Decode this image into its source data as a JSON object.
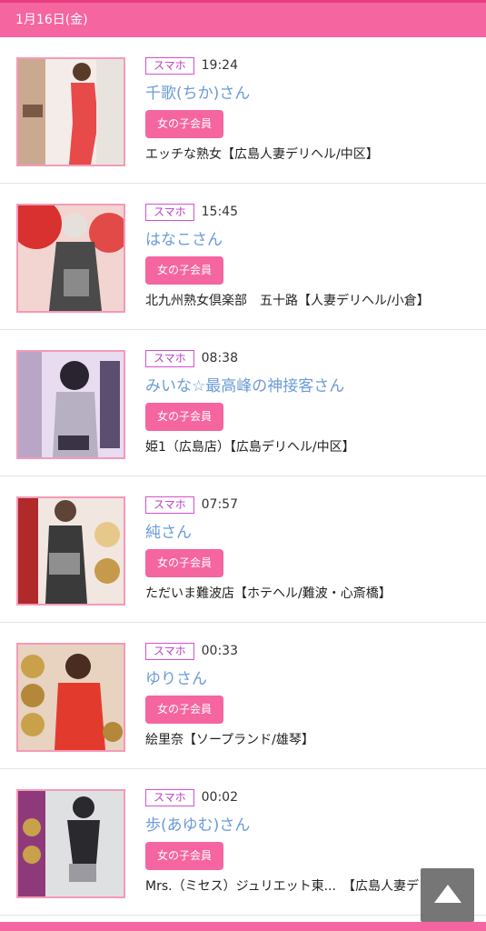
{
  "date_header": "1月16日(金)",
  "items": [
    {
      "device": "スマホ",
      "time": "19:24",
      "name": "千歌(ちか)さん",
      "member": "女の子会員",
      "shop": "エッチな熟女【広島人妻デリヘル/中区】",
      "thumb_colors": [
        "#e84a4a",
        "#f0d5c8",
        "#b13030"
      ]
    },
    {
      "device": "スマホ",
      "time": "15:45",
      "name": "はなこさん",
      "member": "女の子会員",
      "shop": "北九州熟女倶楽部　五十路【人妻デリヘル/小倉】",
      "thumb_colors": [
        "#d8312f",
        "#4a4a4a",
        "#f2d4d0"
      ]
    },
    {
      "device": "スマホ",
      "time": "08:38",
      "name": "みいな☆最高峰の神接客さん",
      "member": "女の子会員",
      "shop": "姫1（広島店）【広島デリヘル/中区】",
      "thumb_colors": [
        "#b9a6c6",
        "#5b4e6e",
        "#e8dcf0"
      ]
    },
    {
      "device": "スマホ",
      "time": "07:57",
      "name": "純さん",
      "member": "女の子会員",
      "shop": "ただいま難波店【ホテヘル/難波・心斎橋】",
      "thumb_colors": [
        "#b02a2a",
        "#3a3a3a",
        "#e6c98a"
      ]
    },
    {
      "device": "スマホ",
      "time": "00:33",
      "name": "ゆりさん",
      "member": "女の子会員",
      "shop": "絵里奈【ソープランド/雄琴】",
      "thumb_colors": [
        "#e8d2c0",
        "#e23b2e",
        "#7b2a1e"
      ]
    },
    {
      "device": "スマホ",
      "time": "00:02",
      "name": "歩(あゆむ)さん",
      "member": "女の子会員",
      "shop": "Mrs.（ミセス）ジュリエット東...　【広島人妻デ",
      "thumb_colors": [
        "#dfe0e2",
        "#2a2a2e",
        "#8e3a7a"
      ]
    }
  ],
  "scroll_top_icon": "triangle-up-icon",
  "accent_color": "#f565a0"
}
